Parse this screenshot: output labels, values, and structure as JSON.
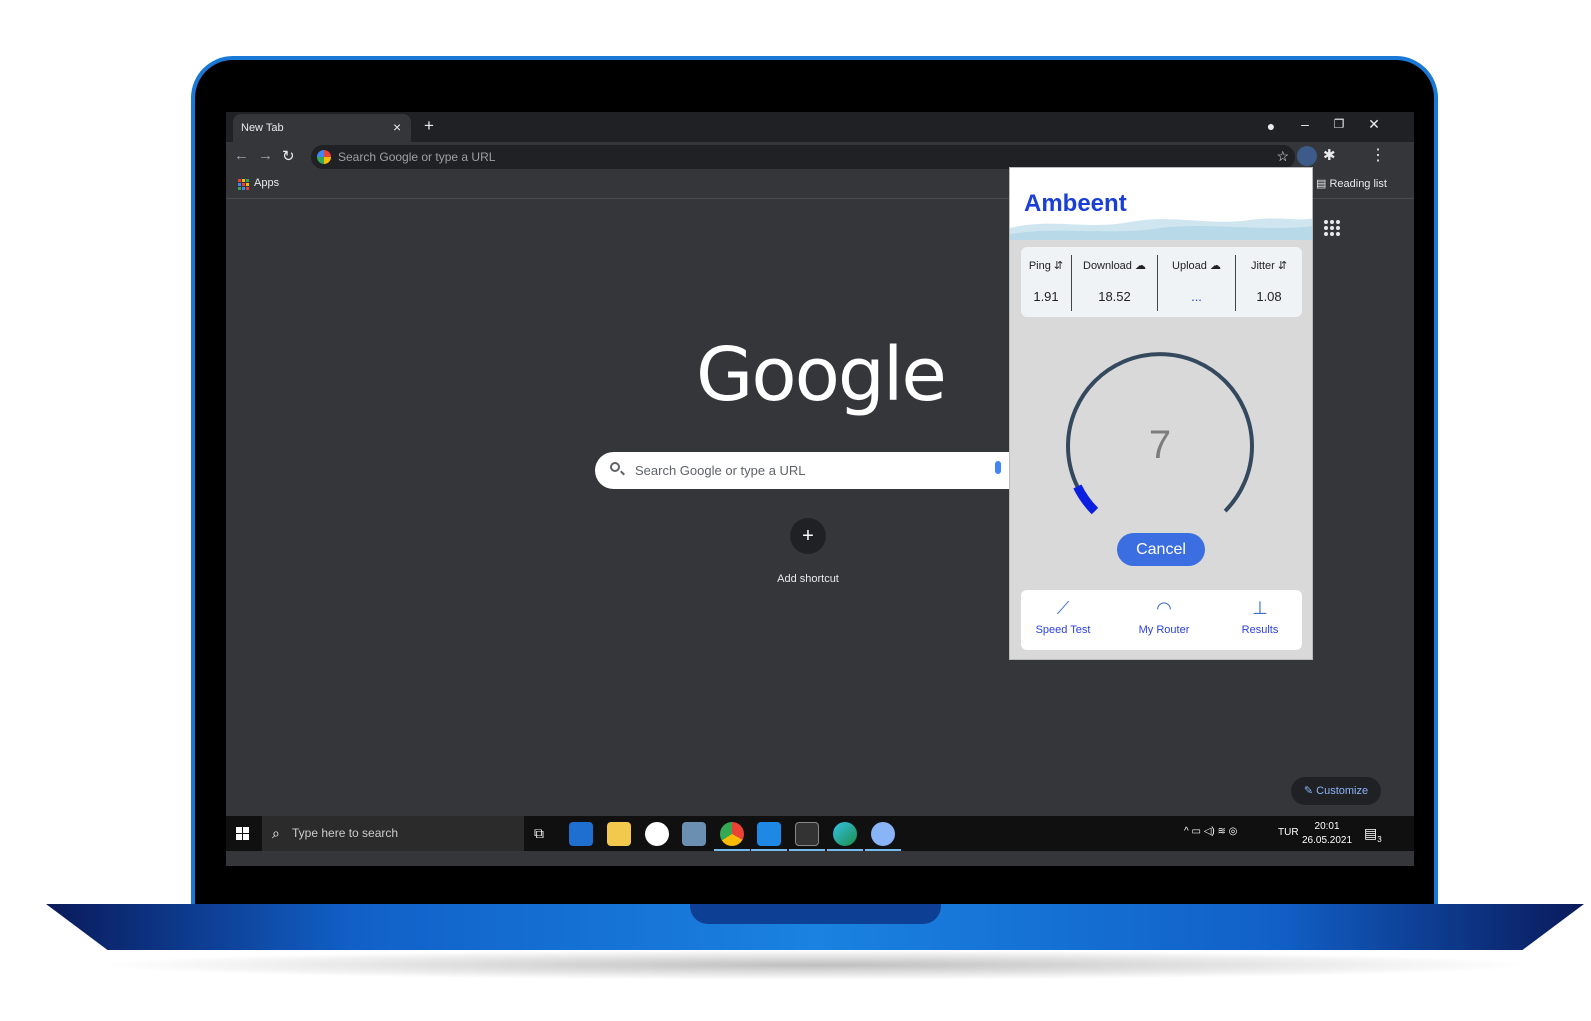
{
  "browser": {
    "tab_title": "New Tab",
    "tab_close": "×",
    "new_tab": "+",
    "window_minimize": "–",
    "window_restore": "❐",
    "window_close": "✕",
    "omnibox_placeholder": "Search Google or type a URL",
    "bookmarks": {
      "apps_label": "Apps",
      "reading_list": "Reading list"
    }
  },
  "ntp": {
    "logo": "Google",
    "search_placeholder": "Search Google or type a URL",
    "add_shortcut_label": "Add shortcut",
    "add_shortcut_symbol": "+",
    "customize_label": "Customize"
  },
  "taskbar": {
    "search_placeholder": "Type here to search",
    "tray_lang": "TUR",
    "time": "20:01",
    "date": "26.05.2021",
    "notification_count": "3"
  },
  "popup": {
    "title": "Ambeent",
    "stats": [
      {
        "label": "Ping ⇵",
        "value": "1.91"
      },
      {
        "label": "Download ☁",
        "value": "18.52"
      },
      {
        "label": "Upload ☁",
        "value": "..."
      },
      {
        "label": "Jitter ⇵",
        "value": "1.08"
      }
    ],
    "gauge_value": "7",
    "gauge_progress": 0.07,
    "cancel_label": "Cancel",
    "nav": [
      {
        "label": "Speed Test",
        "icon": "chart-line-icon"
      },
      {
        "label": "My Router",
        "icon": "router-gauge-icon"
      },
      {
        "label": "Results",
        "icon": "results-icon"
      }
    ]
  },
  "colors": {
    "accent": "#3b6ee0",
    "brand": "#1a3fd6",
    "laptop_border": "#1a78d6"
  }
}
